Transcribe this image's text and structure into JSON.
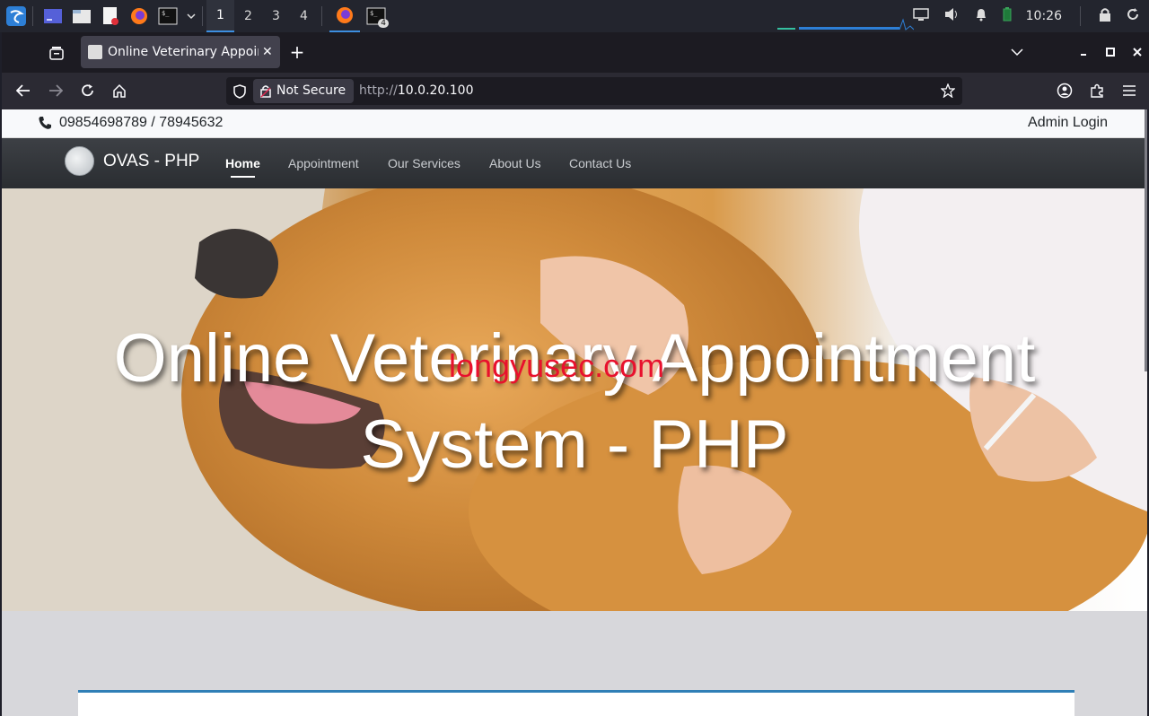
{
  "os": {
    "workspaces": [
      "1",
      "2",
      "3",
      "4"
    ],
    "active_workspace": "1",
    "terminal_badge": "4",
    "clock": "10:26"
  },
  "browser": {
    "tab_title": "Online Veterinary Appointment System - PHP",
    "new_tab_label": "+",
    "security_label": "Not Secure",
    "url_protocol": "http://",
    "url_host": "10.0.20.100"
  },
  "site": {
    "phone": "09854698789 / 78945632",
    "admin_login": "Admin Login",
    "brand": "OVAS - PHP",
    "nav": [
      {
        "label": "Home"
      },
      {
        "label": "Appointment"
      },
      {
        "label": "Our Services"
      },
      {
        "label": "About Us"
      },
      {
        "label": "Contact Us"
      }
    ],
    "hero_line1": "Online Veterinary Appointment",
    "hero_line2": "System - PHP",
    "watermark": "longyusec.com"
  },
  "colors": {
    "accent": "#3d8fe0",
    "card_border": "#2f7fb6",
    "watermark": "#e8112d"
  }
}
